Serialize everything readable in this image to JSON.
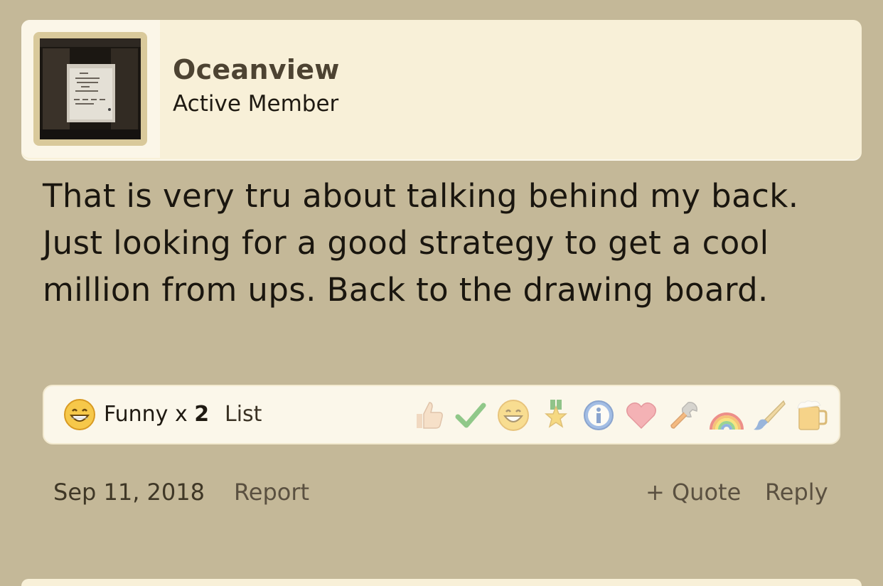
{
  "author": {
    "username": "Oceanview",
    "title": "Active Member"
  },
  "post": {
    "message": "That is very tru about talking behind my back. Just looking for a good strategy to get a cool million from ups. Back to the drawing board."
  },
  "reactions": {
    "summary_label": "Funny x ",
    "summary_count": "2",
    "list_label": "List",
    "picker": [
      "thumbs-up",
      "checkmark",
      "funny",
      "winner",
      "informative",
      "love",
      "useful",
      "rainbow",
      "creative",
      "beer"
    ]
  },
  "footer": {
    "date": "Sep 11, 2018",
    "report_label": "Report",
    "quote_label": "+ Quote",
    "reply_label": "Reply"
  },
  "colors": {
    "page_bg": "#c4b898",
    "card_bg": "#f8f0d8",
    "username": "#4d4332"
  }
}
